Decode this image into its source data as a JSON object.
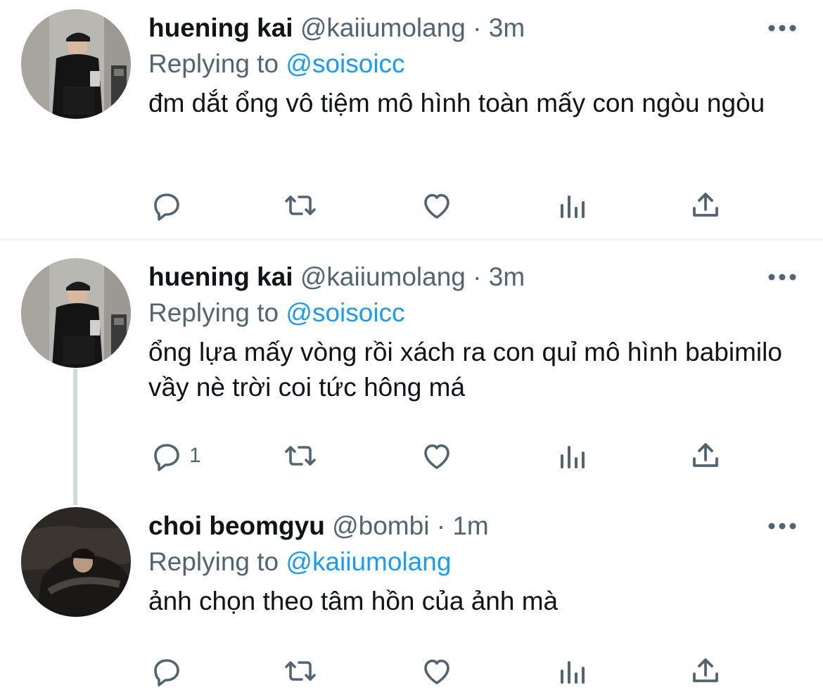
{
  "colors": {
    "accent": "#1d9bf0",
    "secondary_text": "#536471",
    "primary_text": "#0f1419"
  },
  "tweets": [
    {
      "name": "huening kai",
      "handle": "@kaiiumolang",
      "separator": "·",
      "time": "3m",
      "replying_prefix": "Replying to",
      "replying_to": "@soisoicc",
      "text": "đm dắt ổng vô tiệm mô hình toàn mấy con ngòu ngòu",
      "actions": {
        "reply_count": "",
        "retweet_count": "",
        "like_count": "",
        "views_count": ""
      }
    },
    {
      "name": "huening kai",
      "handle": "@kaiiumolang",
      "separator": "·",
      "time": "3m",
      "replying_prefix": "Replying to",
      "replying_to": "@soisoicc",
      "text": "ổng lựa mấy vòng rồi xách ra con quỉ mô hình babimilo vầy nè trời coi tức hông má",
      "actions": {
        "reply_count": "1",
        "retweet_count": "",
        "like_count": "",
        "views_count": ""
      }
    },
    {
      "name": "choi beomgyu",
      "handle": "@bombi",
      "separator": "·",
      "time": "1m",
      "replying_prefix": "Replying to",
      "replying_to": "@kaiiumolang",
      "text": "ảnh chọn theo tâm hồn của ảnh mà",
      "actions": {
        "reply_count": "",
        "retweet_count": "",
        "like_count": "",
        "views_count": ""
      }
    }
  ],
  "icons": [
    "reply-icon",
    "retweet-icon",
    "like-icon",
    "views-icon",
    "share-icon",
    "more-icon"
  ]
}
